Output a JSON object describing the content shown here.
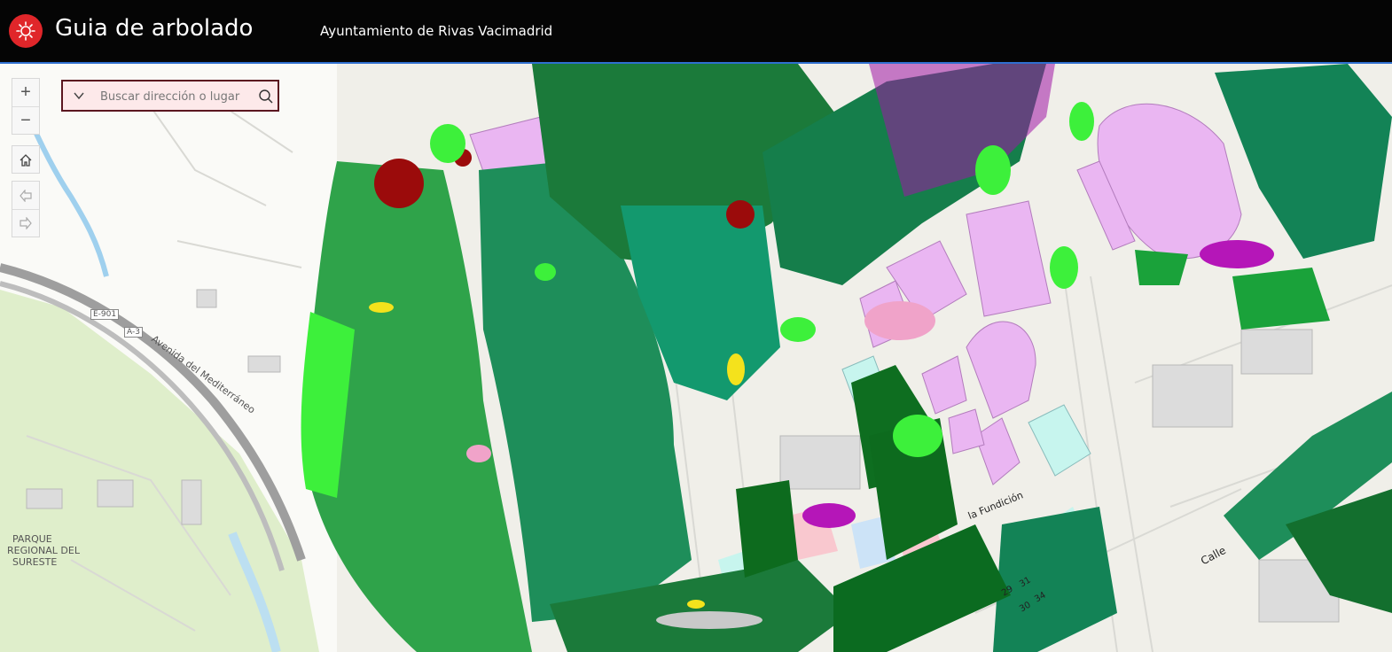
{
  "header": {
    "logo_icon": "city-seal-icon",
    "title": "Guia de arbolado",
    "subtitle": "Ayuntamiento de Rivas Vacimadrid"
  },
  "search": {
    "placeholder": "Buscar dirección o lugar",
    "value": ""
  },
  "map_controls": {
    "zoom_in": "+",
    "zoom_out": "−",
    "home_icon": "home-icon",
    "back_icon": "arrow-left-icon",
    "forward_icon": "arrow-right-icon"
  },
  "map_labels": {
    "park": "PARQUE",
    "park_line2": "REGIONAL DEL",
    "park_line3": "SURESTE",
    "avenue": "Avenida del Mediterráneo",
    "road_e901": "E-901",
    "road_a3": "A-3",
    "street_fundicion": "la Fundición",
    "street_calle": "Calle",
    "number_29": "29",
    "number_31": "31",
    "number_30": "30",
    "number_34": "34"
  },
  "colors": {
    "header_bg": "#050505",
    "accent": "#e0262a",
    "search_bg": "#fde9ea",
    "search_border": "#5b1620"
  }
}
